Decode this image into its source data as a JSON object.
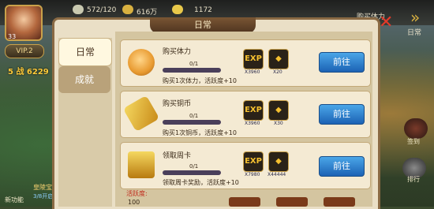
{
  "topbar": {
    "stamina": "572/120",
    "silver": "616万",
    "gold": "1172",
    "right_text": "购买体力",
    "daily_label": "日常"
  },
  "player": {
    "level": "33",
    "vip": "VIP.2",
    "power": "5 战 6229"
  },
  "panel": {
    "title": "日常",
    "tabs": [
      {
        "label": "日常",
        "active": true
      },
      {
        "label": "成就",
        "active": false
      }
    ],
    "tasks": [
      {
        "name": "购买体力",
        "progress": "0/1",
        "progress_fraction": 0,
        "desc": "购买1次体力，活跃度+10",
        "rewards": [
          {
            "glyph": "EXP",
            "count": "X3960"
          },
          {
            "glyph": "GOLD",
            "count": "X20"
          }
        ],
        "button": "前往"
      },
      {
        "name": "购买铜币",
        "progress": "0/1",
        "progress_fraction": 0,
        "desc": "购买1次铜币，活跃度+10",
        "rewards": [
          {
            "glyph": "EXP",
            "count": "X3960"
          },
          {
            "glyph": "GOLD",
            "count": "X30"
          }
        ],
        "button": "前往"
      },
      {
        "name": "领取周卡",
        "progress": "0/1",
        "progress_fraction": 0,
        "desc": "领取周卡奖励，活跃度+10",
        "rewards": [
          {
            "glyph": "EXP",
            "count": "X7980"
          },
          {
            "glyph": "GOLD",
            "count": "X44444"
          }
        ],
        "button": "前往"
      }
    ],
    "activity_label": "活跃度:",
    "activity_value": "100"
  },
  "left_ui": {
    "new_feature": "新功能",
    "event": "皇陵宝藏",
    "event_sub": "3/8开启"
  },
  "right_ui": {
    "label1": "签到",
    "label2": "排行"
  },
  "colors": {
    "button_blue": "#2a7fd0",
    "panel_bg": "#eadfc6",
    "title_brown": "#5e3e24",
    "close_red": "#e23a2a"
  }
}
